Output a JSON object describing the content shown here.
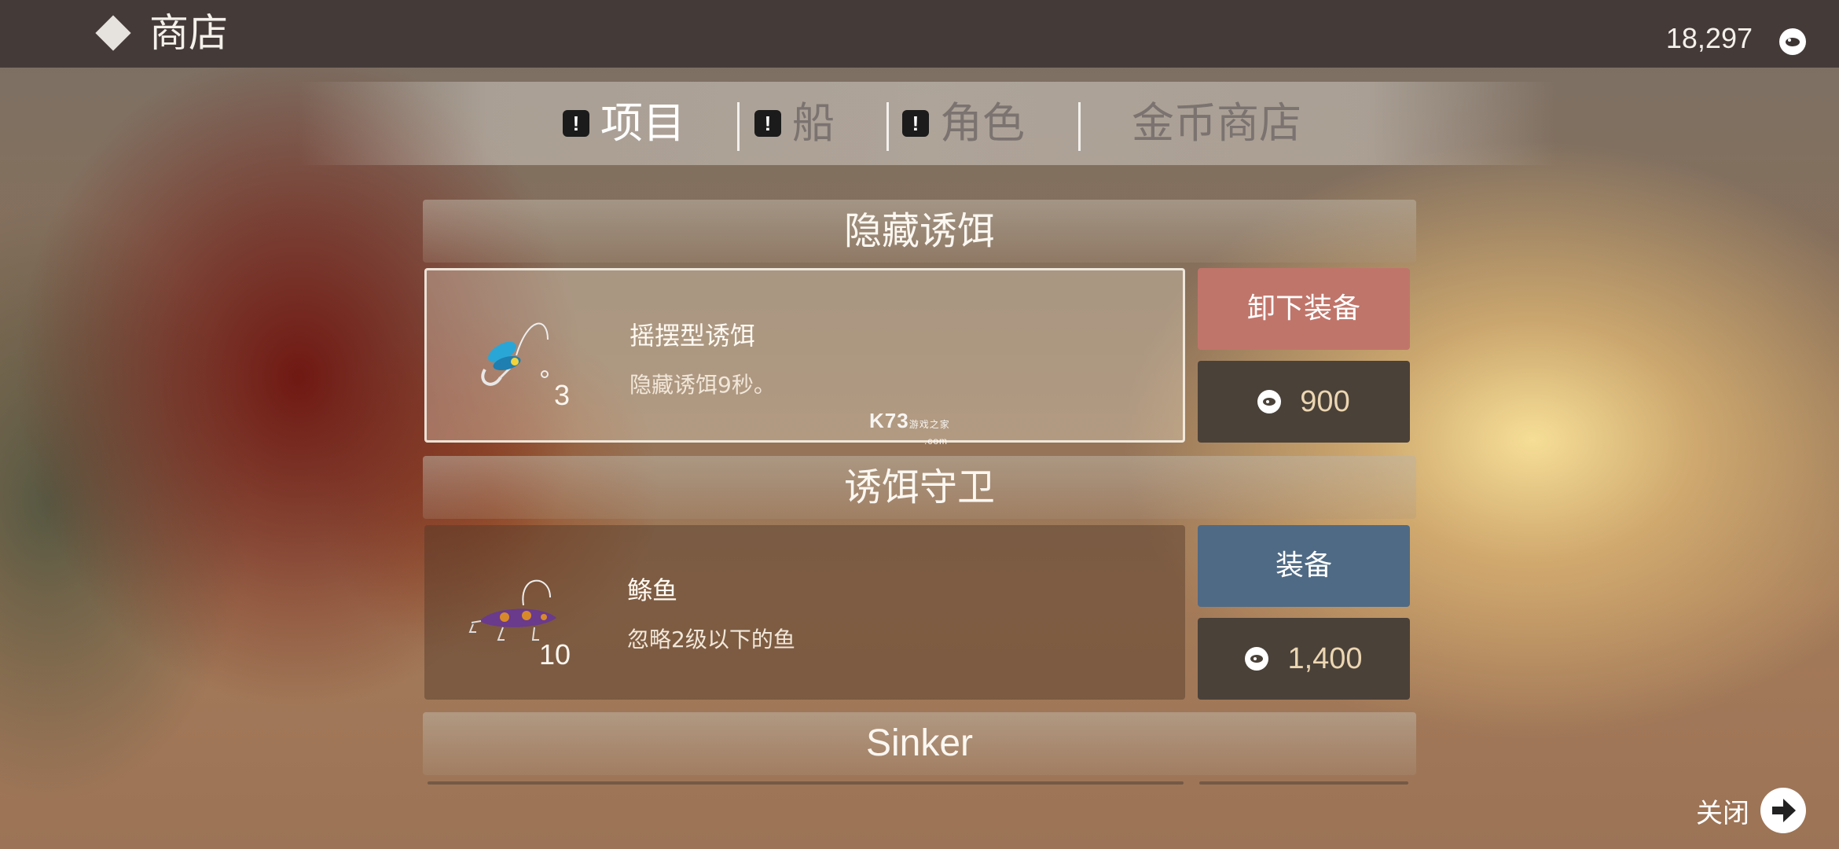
{
  "header": {
    "title": "商店",
    "balance": "18,297"
  },
  "tabs": [
    {
      "label": "项目",
      "alert": "!",
      "active": true
    },
    {
      "label": "船",
      "alert": "!",
      "active": false
    },
    {
      "label": "角色",
      "alert": "!",
      "active": false
    },
    {
      "label": "金币商店",
      "active": false
    }
  ],
  "sections": [
    {
      "title": "隐藏诱饵",
      "item": {
        "name": "摇摆型诱饵",
        "description": "隐藏诱饵9秒。",
        "count": "3",
        "action_label": "卸下装备",
        "price": "900",
        "selected": true
      }
    },
    {
      "title": "诱饵守卫",
      "item": {
        "name": "鲦鱼",
        "description": "忽略2级以下的鱼",
        "count": "10",
        "action_label": "装备",
        "price": "1,400",
        "selected": false
      }
    },
    {
      "title": "Sinker"
    }
  ],
  "watermark": {
    "text": "K73",
    "sub": "游戏之家",
    "domain": ".com"
  },
  "footer": {
    "close_label": "关闭"
  },
  "colors": {
    "topbar": "#443b39",
    "unequip_button": "#c0756a",
    "equip_button": "#4f6a84",
    "price_button": "#4a4139",
    "price_text": "#ecd6b2",
    "inactive_tab": "#7b7370"
  }
}
